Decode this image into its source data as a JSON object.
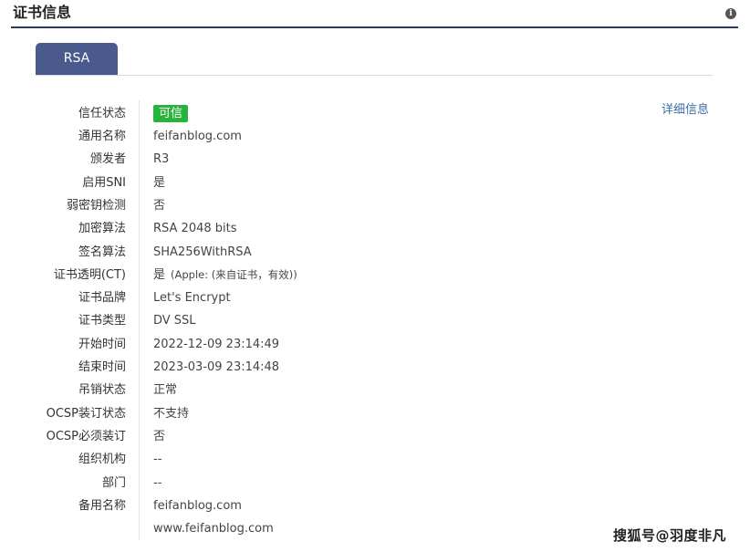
{
  "header": {
    "title": "证书信息",
    "info_icon": "i"
  },
  "tabs": [
    {
      "label": "RSA",
      "active": true
    }
  ],
  "detail_link": "详细信息",
  "trust": {
    "label": "信任状态",
    "value": "可信",
    "color": "#27b33c"
  },
  "fields": [
    {
      "label": "通用名称",
      "value": "feifanblog.com"
    },
    {
      "label": "颁发者",
      "value": "R3"
    },
    {
      "label": "启用SNI",
      "value": "是"
    },
    {
      "label": "弱密钥检测",
      "value": "否"
    },
    {
      "label": "加密算法",
      "value": "RSA 2048 bits"
    },
    {
      "label": "签名算法",
      "value": "SHA256WithRSA"
    },
    {
      "label": "证书透明(CT)",
      "value": "是",
      "sub": "(Apple: (来自证书，有效))"
    },
    {
      "label": "证书品牌",
      "value": "Let's Encrypt"
    },
    {
      "label": "证书类型",
      "value": "DV SSL"
    },
    {
      "label": "开始时间",
      "value": "2022-12-09 23:14:49"
    },
    {
      "label": "结束时间",
      "value": "2023-03-09 23:14:48"
    },
    {
      "label": "吊销状态",
      "value": "正常"
    },
    {
      "label": "OCSP装订状态",
      "value": "不支持"
    },
    {
      "label": "OCSP必须装订",
      "value": "否"
    },
    {
      "label": "组织机构",
      "value": "--"
    },
    {
      "label": "部门",
      "value": "--"
    },
    {
      "label": "备用名称",
      "value": "feifanblog.com"
    },
    {
      "label": "",
      "value": "www.feifanblog.com"
    }
  ],
  "watermark": "搜狐号@羽度非凡",
  "colors": {
    "header_rule": "#2a3a5e",
    "tab_bg": "#4a5a8c",
    "link": "#3a6ea5"
  }
}
